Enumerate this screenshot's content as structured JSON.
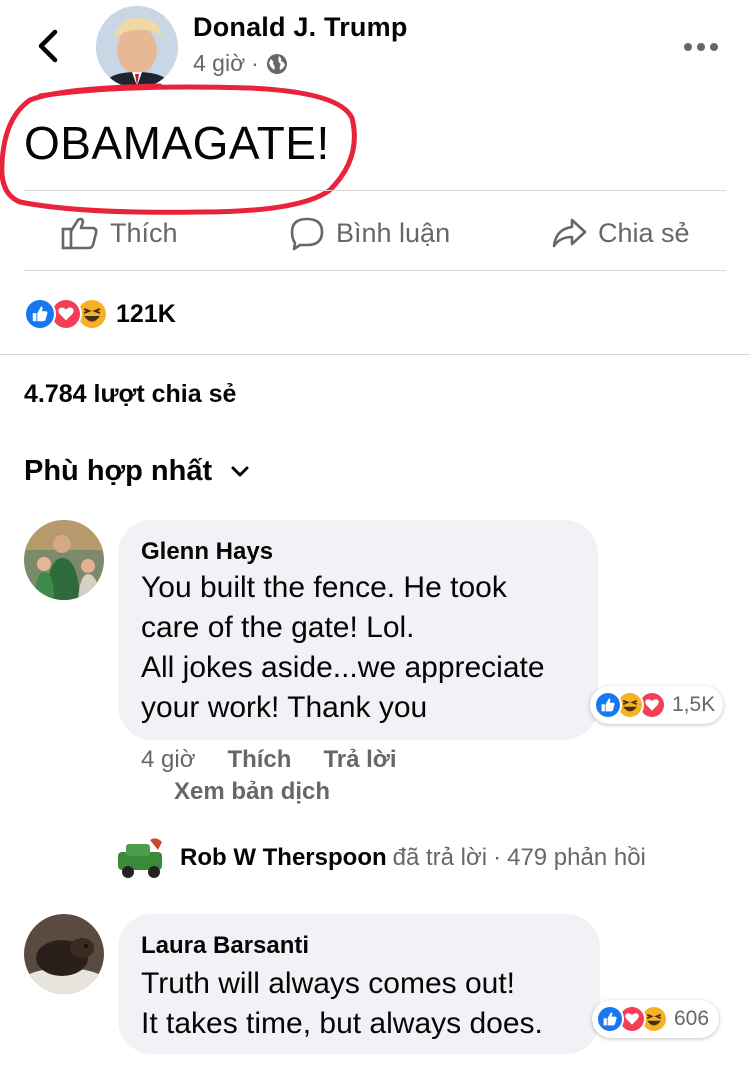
{
  "header": {
    "author": "Donald J. Trump",
    "time": "4 giờ",
    "separator": "·"
  },
  "post": {
    "text": "OBAMAGATE!"
  },
  "actions": {
    "like": "Thích",
    "comment": "Bình luận",
    "share": "Chia sẻ"
  },
  "reactions": {
    "count": "121K"
  },
  "shares": "4.784 lượt chia sẻ",
  "sort": {
    "label": "Phù hợp nhất"
  },
  "comments": [
    {
      "name": "Glenn Hays",
      "lines": [
        "You built the fence. He took",
        "care of the gate! Lol.",
        "All jokes aside...we appreciate",
        "your work! Thank you"
      ],
      "reaction_count": "1,5K",
      "time": "4 giờ",
      "like": "Thích",
      "reply": "Trả lời",
      "translate": "Xem bản dịch"
    },
    {
      "name": "Laura Barsanti",
      "lines": [
        "Truth will always comes out!",
        "It takes time, but always does."
      ],
      "reaction_count": "606"
    }
  ],
  "reply_summary": {
    "name": "Rob W Therspoon",
    "action": "đã trả lời",
    "separator": "·",
    "count": "479 phản hồi"
  },
  "colors": {
    "like_blue": "#1877f2",
    "love_red": "#f33e58",
    "haha_yellow": "#f7b125",
    "annotation_red": "#e8233b",
    "secondary_text": "#65676b",
    "bubble_gray": "#f0f2f5"
  }
}
